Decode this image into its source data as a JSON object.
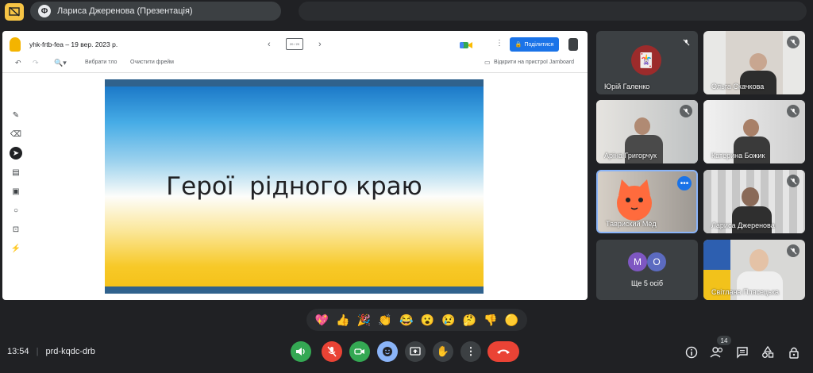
{
  "meeting": {
    "presenter_title": "Лариса Джеренова (Презентація)",
    "time": "13:54",
    "code": "prd-kqdc-drb",
    "participant_count": "14"
  },
  "jamboard": {
    "file_name": "yhk-frtb-fea – 19 вер. 2023 р.",
    "frame_indicator": "20 / 20",
    "share_label": "Поділитися",
    "select_bg_label": "Вибрати тло",
    "clear_frame_label": "Очистити фрейм",
    "open_on_device_label": "Відкрити на пристрої Jamboard",
    "slide_title": "Герої  рідного краю"
  },
  "participants": [
    {
      "name": "Юрій Галенко",
      "muted": true
    },
    {
      "name": "Ольга Скачкова",
      "muted": true
    },
    {
      "name": "Аріна Григорчук",
      "muted": true
    },
    {
      "name": "Катерина Божик",
      "muted": true
    },
    {
      "name": "Тавриский Мёд",
      "muted": false,
      "active": true
    },
    {
      "name": "Лариса Джеренова",
      "muted": true
    },
    {
      "name": "Ще 5 осіб",
      "avatars": [
        "M",
        "O"
      ]
    },
    {
      "name": "Світлана Плясецька",
      "muted": true
    }
  ],
  "reactions": [
    "💖",
    "👍",
    "🎉",
    "👏",
    "😂",
    "😮",
    "😢",
    "🤔",
    "👎",
    "🟡"
  ],
  "colors": {
    "accent_blue": "#1a73e8",
    "end_call_red": "#ea4335",
    "control_green": "#34a853",
    "mic_off_red": "#ea4335",
    "active_tile_border": "#8ab4f8"
  }
}
